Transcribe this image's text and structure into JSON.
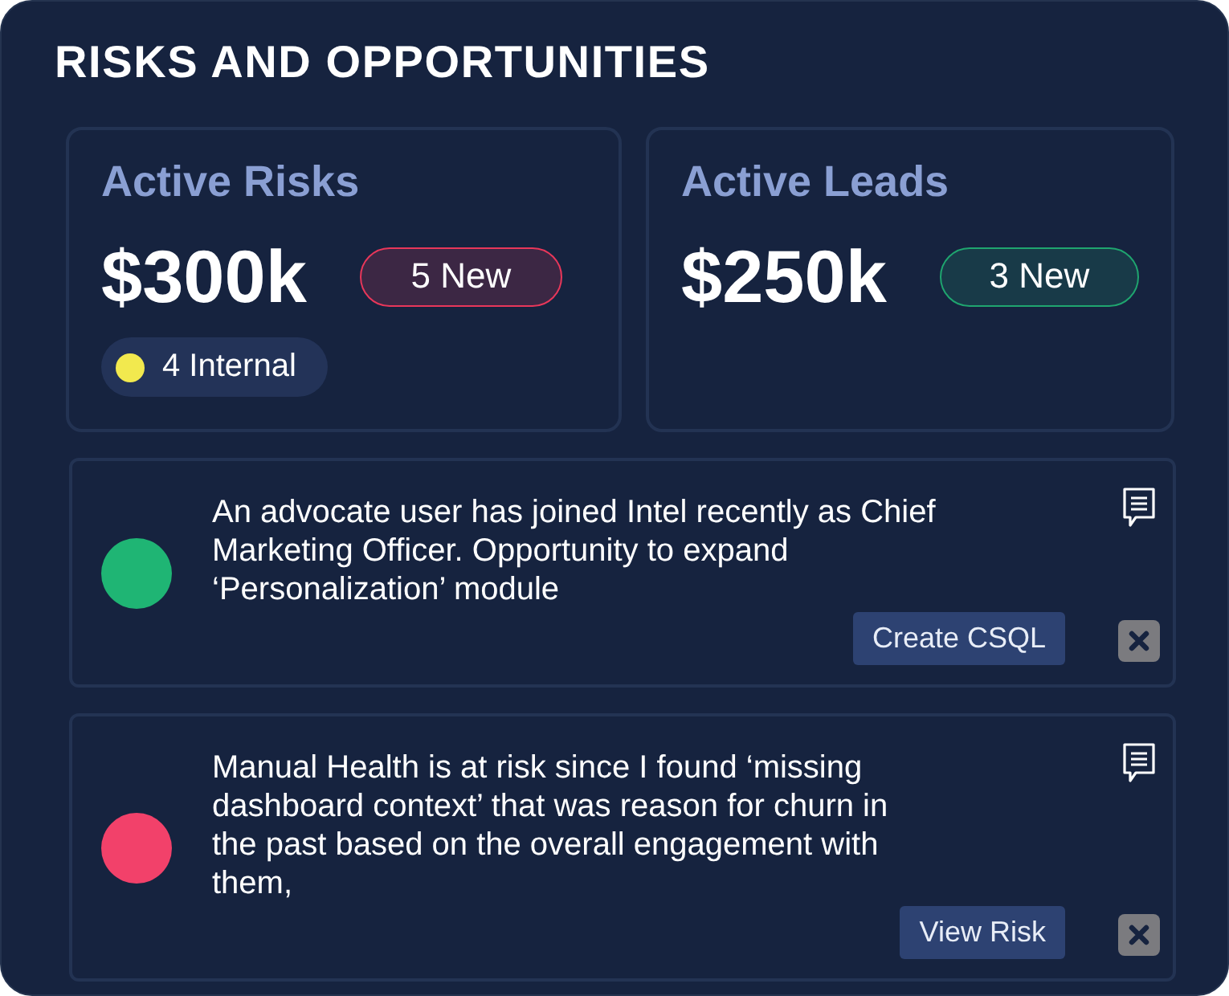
{
  "title": "RISKS AND OPPORTUNITIES",
  "summary_cards": [
    {
      "title": "Active Risks",
      "amount": "$300k",
      "badge": {
        "label": "5 New",
        "color": "#e8375a"
      },
      "tag": {
        "label": "4 Internal",
        "color": "#f2e94e"
      }
    },
    {
      "title": "Active Leads",
      "amount": "$250k",
      "badge": {
        "label": "3 New",
        "color": "#1fa56f"
      }
    }
  ],
  "alerts": [
    {
      "color": "#1fb574",
      "text": "An advocate user has joined Intel recently as Chief Marketing Officer. Opportunity to expand ‘Personalization’ module",
      "action": "Create CSQL"
    },
    {
      "color": "#f2416a",
      "text": "Manual Health is at risk since I found ‘missing dashboard context’ that was reason for churn in the past based on the overall engagement with them,",
      "action": "View Risk"
    }
  ]
}
